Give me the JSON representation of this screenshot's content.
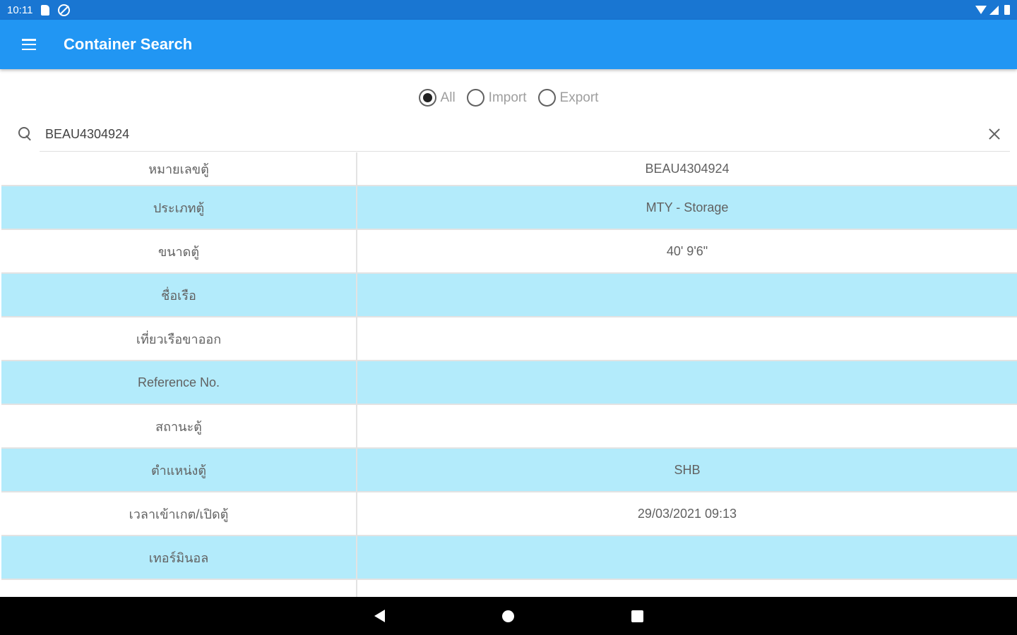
{
  "status_bar": {
    "time": "10:11"
  },
  "app_bar": {
    "title": "Container Search"
  },
  "filter": {
    "options": [
      "All",
      "Import",
      "Export"
    ],
    "selected": "All"
  },
  "search": {
    "value": "BEAU4304924",
    "placeholder": ""
  },
  "details": [
    {
      "label": "หมายเลขตู้",
      "value": "BEAU4304924"
    },
    {
      "label": "ประเภทตู้",
      "value": "MTY - Storage"
    },
    {
      "label": "ขนาดตู้",
      "value": "40' 9'6\""
    },
    {
      "label": "ชื่อเรือ",
      "value": ""
    },
    {
      "label": "เที่ยวเรือขาออก",
      "value": ""
    },
    {
      "label": "Reference No.",
      "value": ""
    },
    {
      "label": "สถานะตู้",
      "value": ""
    },
    {
      "label": "ตำแหน่งตู้",
      "value": "SHB"
    },
    {
      "label": "เวลาเข้าเกต/เปิดตู้",
      "value": "29/03/2021 09:13"
    },
    {
      "label": "เทอร์มินอล",
      "value": ""
    },
    {
      "label": "",
      "value": ""
    }
  ],
  "colors": {
    "status_bar": "#1976d2",
    "app_bar": "#2196f3",
    "row_alt": "#b3ebfb"
  }
}
